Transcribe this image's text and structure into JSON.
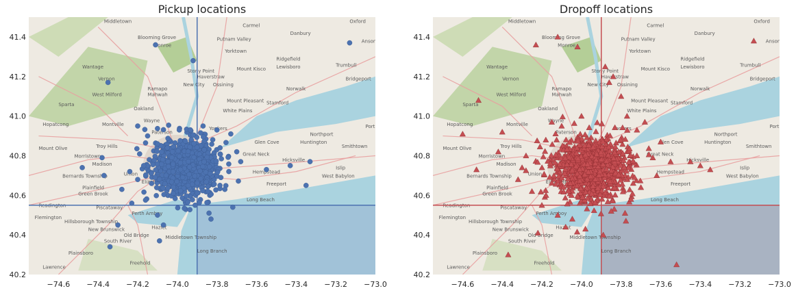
{
  "chart_data": [
    {
      "type": "scatter",
      "title": "Pickup locations",
      "xlabel": "",
      "ylabel": "",
      "xlim": [
        -74.75,
        -73.0
      ],
      "ylim": [
        40.2,
        41.5
      ],
      "xticks": [
        "−74.6",
        "−74.4",
        "−74.2",
        "−74.0",
        "−73.8",
        "−73.6",
        "−73.4",
        "−73.2",
        "−73.0"
      ],
      "yticks": [
        "40.2",
        "40.4",
        "40.6",
        "40.8",
        "41.0",
        "41.2",
        "41.4"
      ],
      "xtick_values": [
        -74.6,
        -74.4,
        -74.2,
        -74.0,
        -73.8,
        -73.6,
        -73.4,
        -73.2,
        -73.0
      ],
      "ytick_values": [
        40.2,
        40.4,
        40.6,
        40.8,
        41.0,
        41.2,
        41.4
      ],
      "marker": "circle",
      "color": "#4c72b0",
      "reference_lines": {
        "x": -73.9,
        "y": 40.55
      },
      "dense_cluster": {
        "center": [
          -73.96,
          40.74
        ],
        "spread": [
          0.08,
          0.07
        ]
      },
      "points": [
        [
          -74.35,
          41.17
        ],
        [
          -74.11,
          41.36
        ],
        [
          -73.13,
          41.37
        ],
        [
          -73.92,
          41.28
        ],
        [
          -74.2,
          40.95
        ],
        [
          -74.38,
          40.79
        ],
        [
          -74.48,
          40.74
        ],
        [
          -74.37,
          40.7
        ],
        [
          -74.15,
          40.9
        ],
        [
          -74.1,
          40.86
        ],
        [
          -74.05,
          40.84
        ],
        [
          -73.99,
          40.93
        ],
        [
          -73.87,
          40.95
        ],
        [
          -73.8,
          40.93
        ],
        [
          -73.73,
          40.91
        ],
        [
          -73.7,
          40.82
        ],
        [
          -73.68,
          40.77
        ],
        [
          -73.55,
          40.73
        ],
        [
          -73.43,
          40.75
        ],
        [
          -73.33,
          40.77
        ],
        [
          -73.35,
          40.65
        ],
        [
          -73.72,
          40.54
        ],
        [
          -73.83,
          40.48
        ],
        [
          -73.84,
          40.51
        ],
        [
          -74.1,
          40.5
        ],
        [
          -73.91,
          40.55
        ],
        [
          -74.02,
          40.61
        ],
        [
          -74.23,
          40.56
        ],
        [
          -74.3,
          40.45
        ],
        [
          -74.34,
          40.34
        ],
        [
          -74.07,
          40.45
        ],
        [
          -74.09,
          40.37
        ],
        [
          -74.28,
          40.63
        ],
        [
          -74.24,
          40.72
        ],
        [
          -74.2,
          40.68
        ],
        [
          -74.17,
          40.75
        ],
        [
          -74.13,
          40.66
        ],
        [
          -73.76,
          40.63
        ],
        [
          -73.78,
          40.69
        ],
        [
          -73.74,
          40.72
        ]
      ],
      "map_labels": [
        "Middletown",
        "Blooming Grove",
        "Monroe",
        "Putnam Valley",
        "Yorktown",
        "Carmel",
        "Danbury",
        "Oxford",
        "Ansonia",
        "Wantage",
        "Vernon",
        "West Milford",
        "Ramapo",
        "Stony Point",
        "Haverstraw",
        "New City",
        "Ossining",
        "Mount Kisco",
        "Ridgefield",
        "Lewisboro",
        "Trumbull",
        "Bridgeport",
        "Norwalk",
        "Stamford",
        "Sparta",
        "Oakland",
        "Mahwah",
        "Wayne",
        "White Plains",
        "Mount Pleasant",
        "Hopatcong",
        "Montville",
        "Paterson",
        "Yonkers",
        "Port Jefferson",
        "Mount Olive",
        "Troy Hills",
        "Morristown",
        "Madison",
        "Glen Cove",
        "Huntington",
        "Northport",
        "Smithtown",
        "Great Neck",
        "Hicksville",
        "Islip",
        "Bernards Township",
        "Plainfield",
        "Union",
        "Elizabeth",
        "Hempstead",
        "West Babylon",
        "Freeport",
        "Green Brook",
        "Long Beach",
        "Readington",
        "Piscataway",
        "Flemington",
        "Hillsborough Township",
        "Perth Amboy",
        "New Brunswick",
        "South River",
        "Old Bridge",
        "Hazlet",
        "Middletown Township",
        "Plainsboro",
        "Freehold",
        "Long Branch",
        "Lawrence"
      ]
    },
    {
      "type": "scatter",
      "title": "Dropoff locations",
      "xlabel": "",
      "ylabel": "",
      "xlim": [
        -74.75,
        -73.0
      ],
      "ylim": [
        40.2,
        41.5
      ],
      "xticks": [
        "−74.6",
        "−74.4",
        "−74.2",
        "−74.0",
        "−73.8",
        "−73.6",
        "−73.4",
        "−73.2",
        "−73.0"
      ],
      "yticks": [
        "40.2",
        "40.4",
        "40.6",
        "40.8",
        "41.0",
        "41.2",
        "41.4"
      ],
      "xtick_values": [
        -74.6,
        -74.4,
        -74.2,
        -74.0,
        -73.8,
        -73.6,
        -73.4,
        -73.2,
        -73.0
      ],
      "ytick_values": [
        40.2,
        40.4,
        40.6,
        40.8,
        41.0,
        41.2,
        41.4
      ],
      "marker": "triangle",
      "color": "#c44e52",
      "reference_lines": {
        "x": -73.9,
        "y": 40.55
      },
      "dense_cluster": {
        "center": [
          -73.95,
          40.74
        ],
        "spread": [
          0.1,
          0.08
        ]
      },
      "points": [
        [
          -74.23,
          41.36
        ],
        [
          -74.12,
          41.4
        ],
        [
          -74.02,
          41.35
        ],
        [
          -73.13,
          41.38
        ],
        [
          -73.86,
          41.17
        ],
        [
          -73.88,
          41.25
        ],
        [
          -74.52,
          41.08
        ],
        [
          -74.6,
          40.91
        ],
        [
          -74.4,
          40.92
        ],
        [
          -74.42,
          40.82
        ],
        [
          -74.53,
          40.73
        ],
        [
          -74.37,
          40.3
        ],
        [
          -74.22,
          40.41
        ],
        [
          -74.08,
          40.44
        ],
        [
          -73.89,
          40.4
        ],
        [
          -73.98,
          40.43
        ],
        [
          -73.52,
          40.25
        ],
        [
          -73.64,
          40.79
        ],
        [
          -73.55,
          40.77
        ],
        [
          -73.45,
          40.77
        ],
        [
          -73.4,
          40.75
        ],
        [
          -73.35,
          40.73
        ],
        [
          -73.77,
          41.0
        ],
        [
          -73.72,
          40.93
        ],
        [
          -73.68,
          40.97
        ],
        [
          -74.15,
          40.97
        ],
        [
          -74.18,
          40.88
        ],
        [
          -74.1,
          40.95
        ],
        [
          -73.84,
          41.2
        ],
        [
          -73.8,
          41.1
        ],
        [
          -74.3,
          40.74
        ],
        [
          -74.25,
          40.62
        ],
        [
          -74.2,
          40.55
        ],
        [
          -74.12,
          40.5
        ],
        [
          -73.85,
          40.52
        ],
        [
          -73.78,
          40.51
        ],
        [
          -73.75,
          40.58
        ],
        [
          -73.7,
          40.64
        ],
        [
          -73.62,
          40.7
        ],
        [
          -74.05,
          40.6
        ],
        [
          -74.32,
          40.68
        ],
        [
          -74.28,
          40.8
        ],
        [
          -73.6,
          40.87
        ],
        [
          -74.0,
          41.0
        ]
      ],
      "map_labels": [
        "Middletown",
        "Blooming Grove",
        "Monroe",
        "Putnam Valley",
        "Yorktown",
        "Carmel",
        "Danbury",
        "Oxford",
        "Ansonia",
        "Wantage",
        "Vernon",
        "West Milford",
        "Ramapo",
        "Stony Point",
        "Haverstraw",
        "New City",
        "Ossining",
        "Mount Kisco",
        "Ridgefield",
        "Lewisboro",
        "Trumbull",
        "Bridgeport",
        "Norwalk",
        "Stamford",
        "Sparta",
        "Oakland",
        "Mahwah",
        "Wayne",
        "White Plains",
        "Mount Pleasant",
        "Hopatcong",
        "Montville",
        "Paterson",
        "Yonkers",
        "Port Jefferson",
        "Mount Olive",
        "Troy Hills",
        "Morristown",
        "Madison",
        "Glen Cove",
        "Huntington",
        "Northport",
        "Smithtown",
        "Great Neck",
        "Hicksville",
        "Islip",
        "Bernards Township",
        "Plainfield",
        "Union",
        "Elizabeth",
        "Hempstead",
        "West Babylon",
        "Freeport",
        "Green Brook",
        "Long Beach",
        "Readington",
        "Piscataway",
        "Flemington",
        "Hillsborough Township",
        "Perth Amboy",
        "New Brunswick",
        "South River",
        "Old Bridge",
        "Hazlet",
        "Middletown Township",
        "Plainsboro",
        "Freehold",
        "Long Branch",
        "Lawrence"
      ]
    }
  ]
}
